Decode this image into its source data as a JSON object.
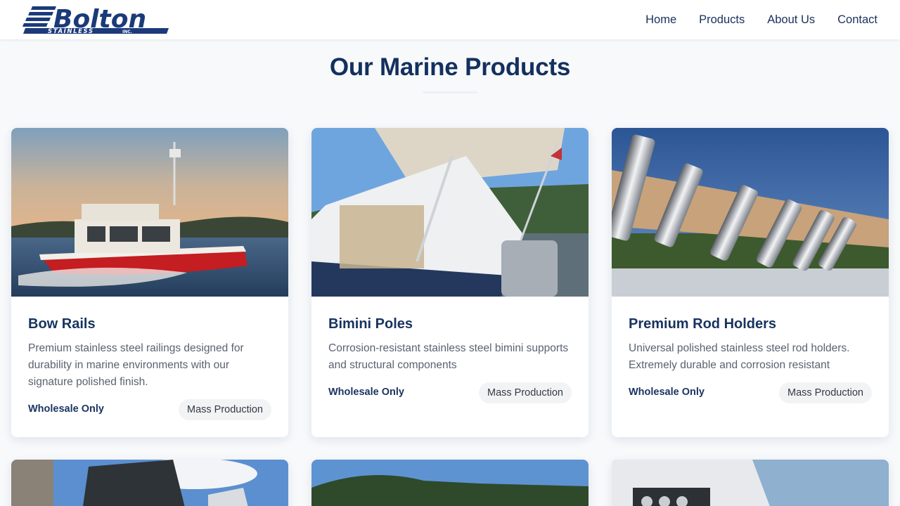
{
  "brand": {
    "name": "Bolton",
    "sub": "STAINLESS",
    "inc": "INC.",
    "color": "#1b3a7a"
  },
  "nav": {
    "items": [
      "Home",
      "Products",
      "About Us",
      "Contact"
    ]
  },
  "page": {
    "heading": "Our Marine Products"
  },
  "products": [
    {
      "title": "Bow Rails",
      "description": "Premium stainless steel railings designed for durability in marine environments with our signature polished finish.",
      "wholesale": "Wholesale Only",
      "badge": "Mass Production",
      "image": "red-boat-photo"
    },
    {
      "title": "Bimini Poles",
      "description": "Corrosion-resistant stainless steel bimini supports and structural components",
      "wholesale": "Wholesale Only",
      "badge": "Mass Production",
      "image": "bimini-boat-photo"
    },
    {
      "title": "Premium Rod Holders",
      "description": "Universal polished stainless steel rod holders. Extremely durable and corrosion resistant",
      "wholesale": "Wholesale Only",
      "badge": "Mass Production",
      "image": "rod-holders-photo"
    }
  ],
  "colors": {
    "navy": "#13305e",
    "background": "#f7f9fb",
    "badge_bg": "#f2f3f5"
  }
}
